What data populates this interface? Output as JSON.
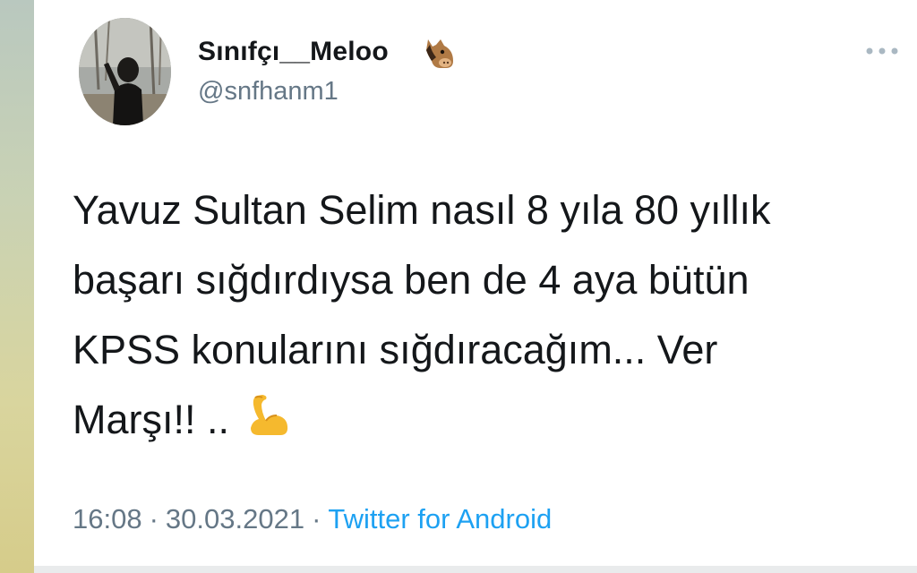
{
  "tweet": {
    "author": {
      "display_name": "Sınıfçı__Meloo",
      "name_emoji": "horse-face-icon",
      "handle": "@snfhanm1",
      "avatar": "profile-photo"
    },
    "menu_icon": "more-options-icon",
    "text_lines": [
      "Yavuz Sultan Selim nasıl 8 yıla 80 yıllık",
      "başarı sığdırdıysa ben de 4 aya bütün",
      "KPSS konularını sığdıracağım... Ver",
      "Marşı!! .."
    ],
    "text_emoji": "flexed-biceps-icon",
    "time": "16:08",
    "date": "30.03.2021",
    "separator": "·",
    "source": "Twitter for Android"
  },
  "colors": {
    "text": "#14171a",
    "secondary_text": "#657786",
    "link": "#1da1f2",
    "emoji_yellow": "#f5b92e"
  }
}
